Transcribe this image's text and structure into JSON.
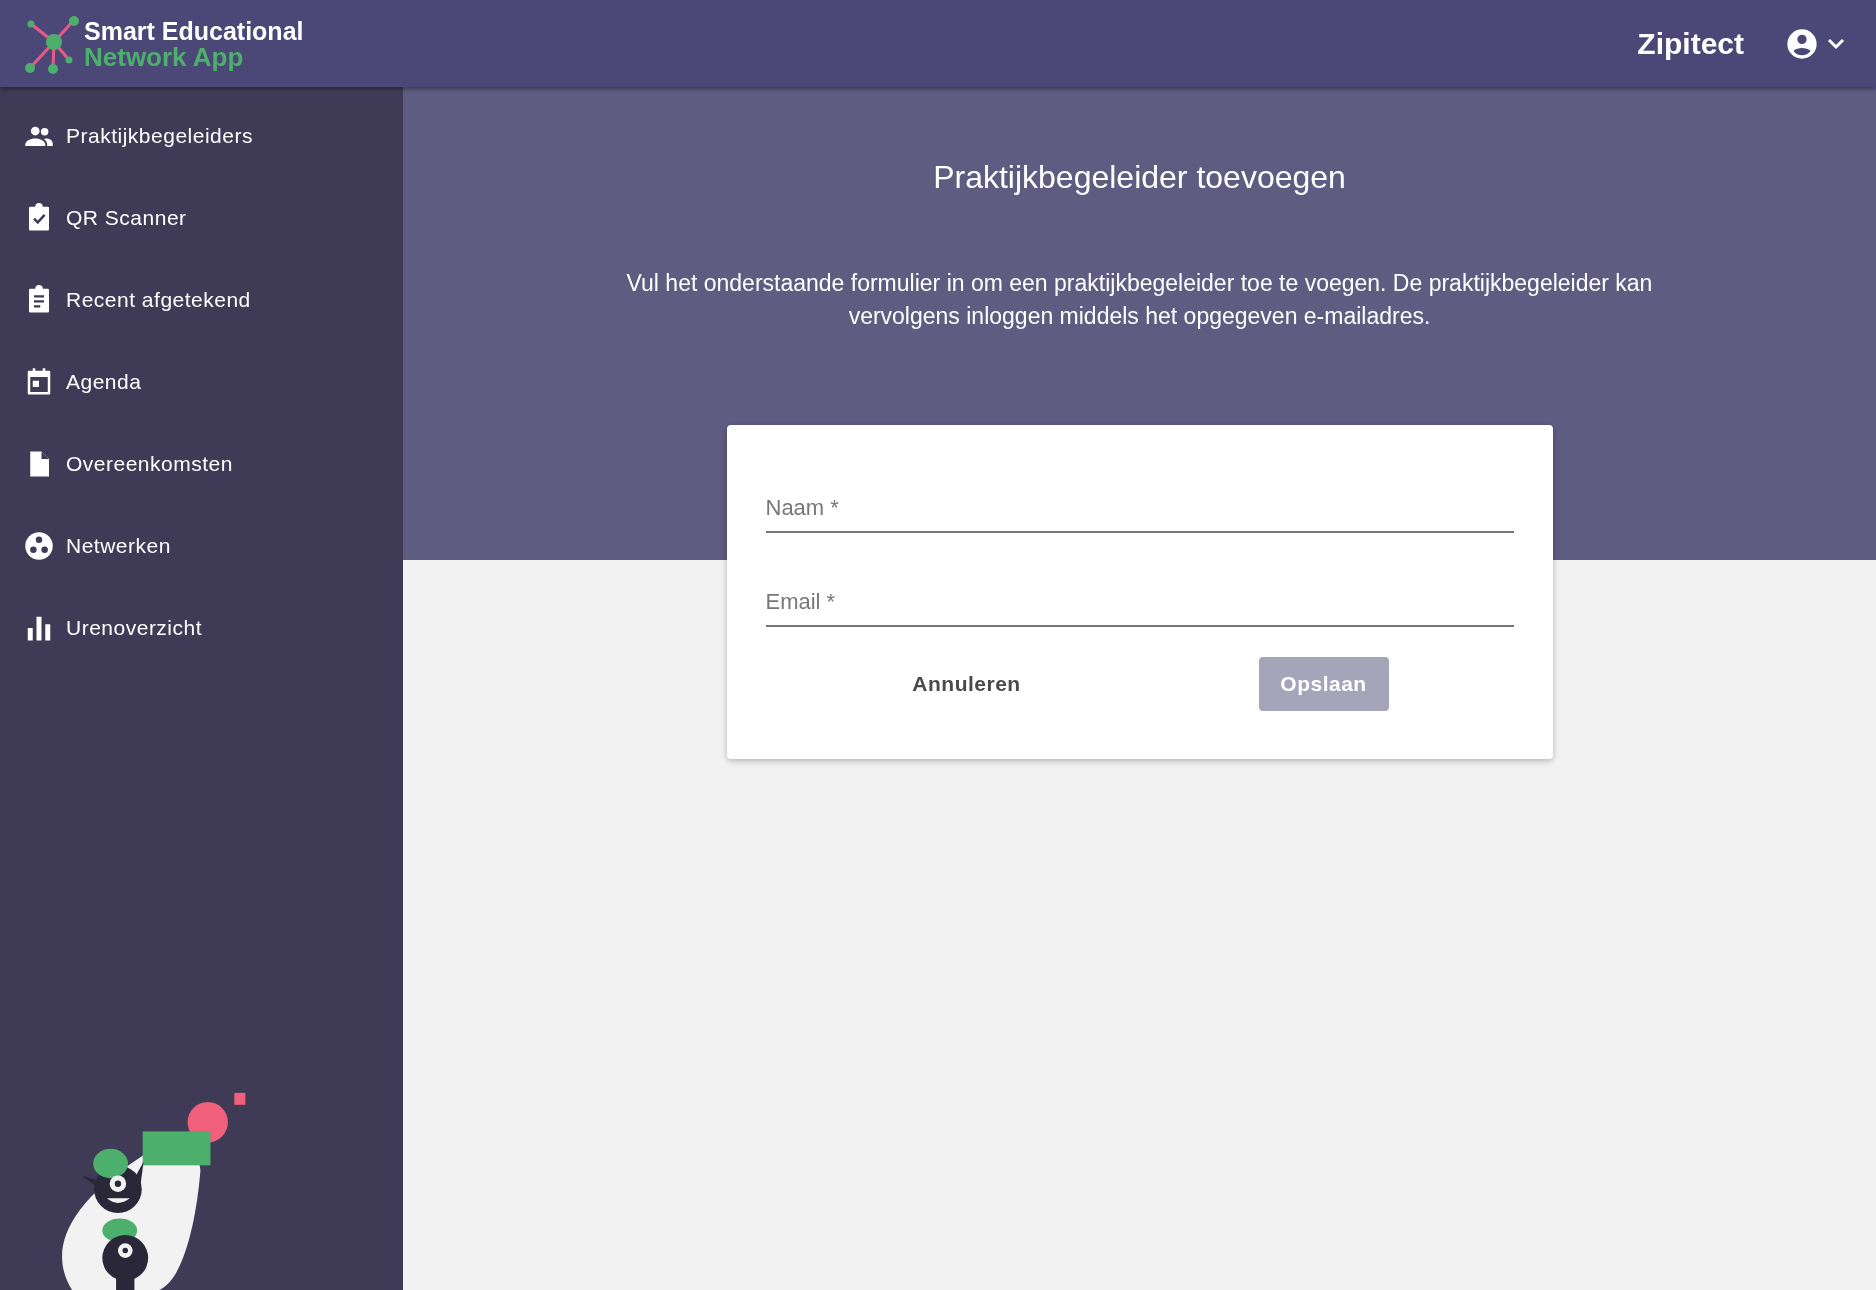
{
  "header": {
    "logo_line_1": "Smart Educational",
    "logo_line_2": "Network App",
    "user_name": "Zipitect"
  },
  "sidebar": {
    "items": [
      {
        "label": "Praktijkbegeleiders",
        "selected": false
      },
      {
        "label": "QR Scanner",
        "selected": false
      },
      {
        "label": "Recent afgetekend",
        "selected": false
      },
      {
        "label": "Agenda",
        "selected": false
      },
      {
        "label": "Overeenkomsten",
        "selected": false
      },
      {
        "label": "Netwerken",
        "selected": false
      },
      {
        "label": "Urenoverzicht",
        "selected": false
      }
    ]
  },
  "page": {
    "title": "Praktijkbegeleider toevoegen",
    "intro": "Vul het onderstaande formulier in om een praktijkbegeleider toe te voegen. De praktijkbegeleider kan vervolgens inloggen middels het opgegeven e-mailadres."
  },
  "form": {
    "fields": [
      {
        "placeholder": "Naam *"
      },
      {
        "placeholder": "Email *"
      }
    ],
    "cancel_button": {
      "label": "Annuleren"
    },
    "save_button": {
      "label": "Opslaan",
      "disabled": true
    }
  }
}
